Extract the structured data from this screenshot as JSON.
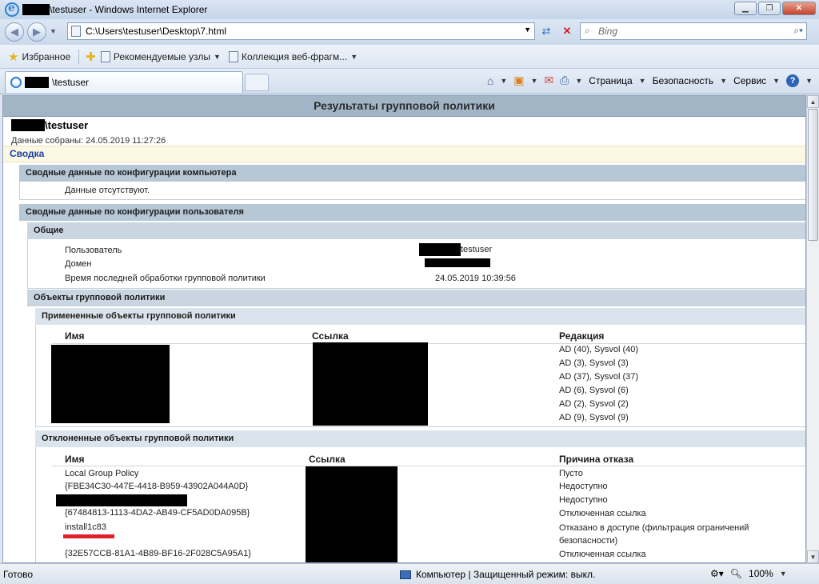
{
  "window": {
    "title_suffix": "\\testuser - Windows Internet Explorer",
    "minimize": "0",
    "maximize": "1",
    "close": "r"
  },
  "address": {
    "url": "C:\\Users\\testuser\\Desktop\\7.html",
    "search_placeholder": "Bing"
  },
  "favorites": {
    "favorites_label": "Избранное",
    "suggested_label": "Рекомендуемые узлы",
    "gallery_label": "Коллекция веб-фрагм..."
  },
  "tab": {
    "label_suffix": "\\testuser"
  },
  "commands": {
    "page": "Страница",
    "safety": "Безопасность",
    "tools": "Сервис"
  },
  "report": {
    "title": "Результаты групповой политики",
    "host_suffix": "\\testuser",
    "collected": "Данные собраны: 24.05.2019 11:27:26",
    "summary_link": "Сводка",
    "computer_section": "Сводные данные по конфигурации компьютера",
    "computer_nodata": "Данные отсутствуют.",
    "user_section": "Сводные данные по конфигурации пользователя",
    "general": "Общие",
    "user_label": "Пользователь",
    "user_value_suffix": "testuser",
    "domain_label": "Домен",
    "last_processing_label": "Время последней обработки групповой политики",
    "last_processing_value": "24.05.2019 10:39:56",
    "gpo_section": "Объекты групповой политики",
    "applied_section": "Примененные объекты групповой политики",
    "applied_headers": [
      "Имя",
      "Ссылка",
      "Редакция"
    ],
    "applied_revisions": [
      "AD (40), Sysvol (40)",
      "AD (3), Sysvol (3)",
      "AD (37), Sysvol (37)",
      "AD (6), Sysvol (6)",
      "AD (2), Sysvol (2)",
      "AD (9), Sysvol (9)"
    ],
    "denied_section": "Отклоненные объекты групповой политики",
    "denied_headers": [
      "Имя",
      "Ссылка",
      "Причина отказа"
    ],
    "denied_names": [
      "Local Group Policy",
      "{FBE34C30-447E-4418-B959-43902A044A0D}",
      "",
      "{67484813-1113-4DA2-AB49-CF5AD0DA095B}",
      "install1c83",
      "{32E57CCB-81A1-4B89-BF16-2F028C5A95A1}"
    ],
    "denied_reasons": [
      "Пусто",
      "Недоступно",
      "Недоступно",
      "Отключенная ссылка",
      "Отказано в доступе (фильтрация ограничений",
      "безопасности)",
      "Отключенная ссылка"
    ]
  },
  "status": {
    "ready": "Готово",
    "zone": "Компьютер | Защищенный режим: выкл.",
    "zoom": "100%"
  }
}
